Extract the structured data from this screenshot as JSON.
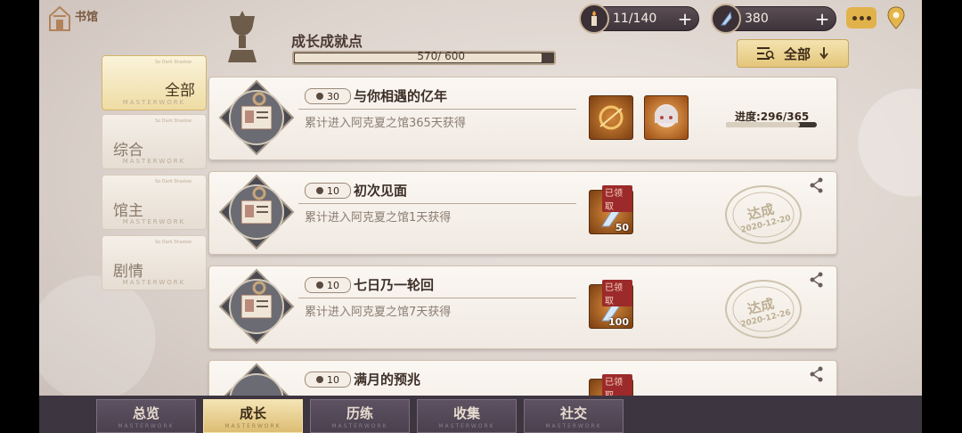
{
  "header": {
    "home_label": "书馆",
    "stamina": "11/140",
    "crystals": "380"
  },
  "section": {
    "title": "成长成就点",
    "progress_text": "570/ 600",
    "progress_value": 0.95,
    "filter_label": "全部"
  },
  "side_tabs": [
    {
      "label": "全部",
      "tag": "MASTERWORK",
      "small": "So Dark Shadow",
      "active": true
    },
    {
      "label": "综合",
      "tag": "MASTERWORK",
      "small": "So Dark Shadow",
      "active": false
    },
    {
      "label": "馆主",
      "tag": "MASTERWORK",
      "small": "So Dark Shadow",
      "active": false
    },
    {
      "label": "剧情",
      "tag": "MASTERWORK",
      "small": "So Dark Shadow",
      "active": false
    }
  ],
  "achievements": [
    {
      "points": "30",
      "title": "与你相遇的亿年",
      "desc": "累计进入阿克夏之馆365天获得",
      "progress_label": "进度:296/365",
      "progress_value": 0.81
    },
    {
      "points": "10",
      "title": "初次见面",
      "desc": "累计进入阿克夏之馆1天获得",
      "reward_count": "50",
      "claimed": "已领取",
      "stamp": "达成",
      "date": "2020-12-20"
    },
    {
      "points": "10",
      "title": "七日乃一轮回",
      "desc": "累计进入阿克夏之馆7天获得",
      "reward_count": "100",
      "claimed": "已领取",
      "stamp": "达成",
      "date": "2020-12-26"
    },
    {
      "points": "10",
      "title": "满月的预兆",
      "claimed": "已领取"
    }
  ],
  "bottom_tabs": [
    {
      "label": "总览",
      "tag": "MASTERWORK",
      "active": false
    },
    {
      "label": "成长",
      "tag": "MASTERWORK",
      "active": true
    },
    {
      "label": "历练",
      "tag": "MASTERWORK",
      "active": false
    },
    {
      "label": "收集",
      "tag": "MASTERWORK",
      "active": false
    },
    {
      "label": "社交",
      "tag": "MASTERWORK",
      "active": false
    }
  ],
  "colors": {
    "accent_gold": "#e4c67a",
    "bar_dark": "#3d3540"
  }
}
